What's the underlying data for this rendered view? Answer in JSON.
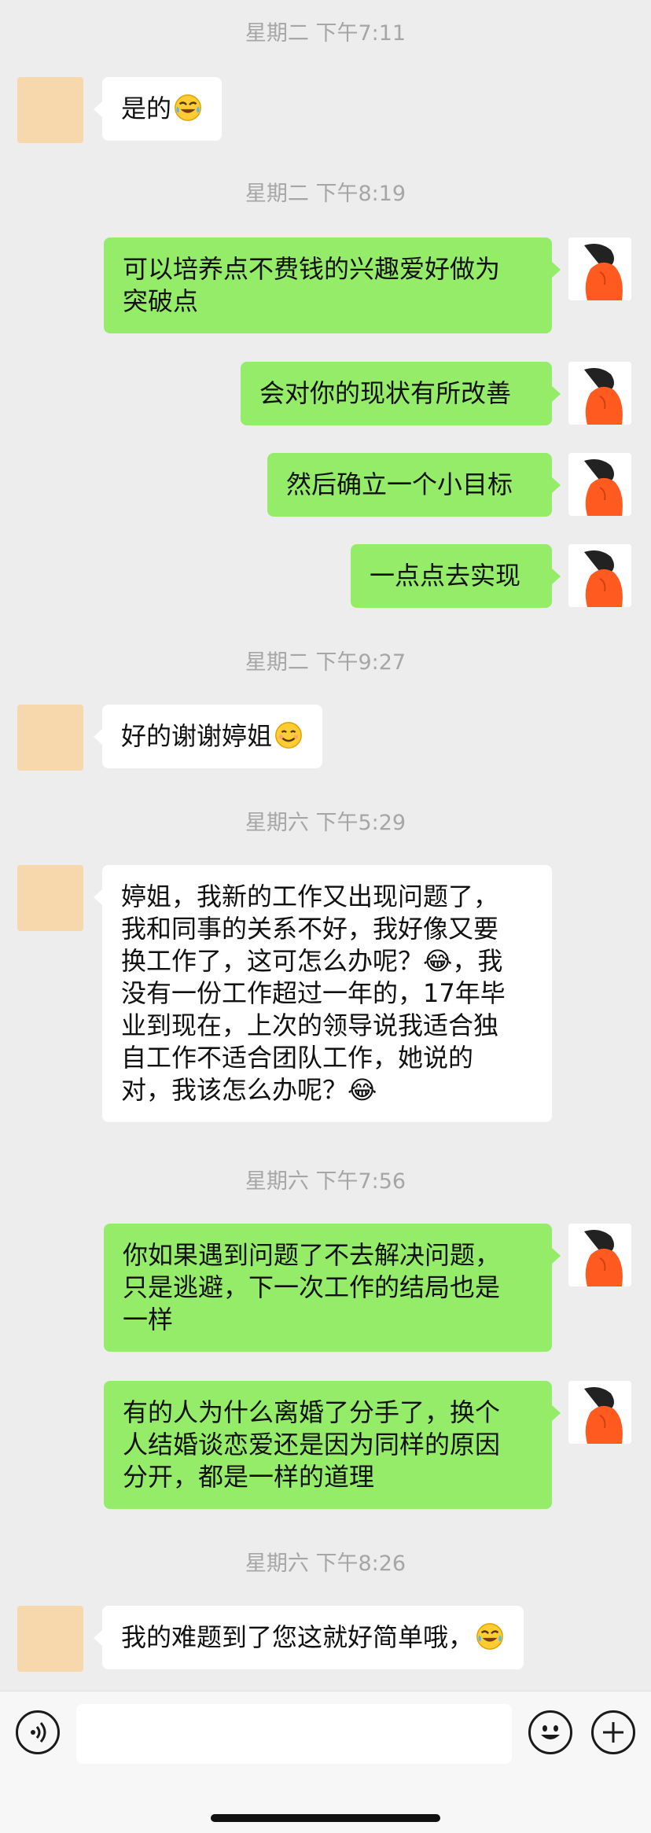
{
  "conversation": [
    {
      "kind": "timestamp",
      "text": "星期二 下午7:11"
    },
    {
      "kind": "message",
      "sender": "them",
      "text": "是的",
      "emoji": "rofl-emoji"
    },
    {
      "kind": "timestamp",
      "text": "星期二 下午8:19"
    },
    {
      "kind": "message",
      "sender": "me",
      "text": "可以培养点不费钱的兴趣爱好做为\n突破点"
    },
    {
      "kind": "message",
      "sender": "me",
      "text": "会对你的现状有所改善"
    },
    {
      "kind": "message",
      "sender": "me",
      "text": "然后确立一个小目标"
    },
    {
      "kind": "message",
      "sender": "me",
      "text": "一点点去实现"
    },
    {
      "kind": "timestamp",
      "text": "星期二 下午9:27"
    },
    {
      "kind": "message",
      "sender": "them",
      "text": "好的谢谢婷姐",
      "emoji": "smile-emoji"
    },
    {
      "kind": "timestamp",
      "text": "星期六 下午5:29"
    },
    {
      "kind": "message",
      "sender": "them",
      "text": "婷姐，我新的工作又出现问题了，\n我和同事的关系不好，我好像又要\n换工作了，这可怎么办呢？😂，我\n没有一份工作超过一年的，17年毕\n业到现在，上次的领导说我适合独\n自工作不适合团队工作，她说的\n对，我该怎么办呢？😂"
    },
    {
      "kind": "timestamp",
      "text": "星期六 下午7:56"
    },
    {
      "kind": "message",
      "sender": "me",
      "text": "你如果遇到问题了不去解决问题，\n只是逃避，下一次工作的结局也是\n一样"
    },
    {
      "kind": "message",
      "sender": "me",
      "text": "有的人为什么离婚了分手了，换个\n人结婚谈恋爱还是因为同样的原因\n分开，都是一样的道理"
    },
    {
      "kind": "timestamp",
      "text": "星期六 下午8:26"
    },
    {
      "kind": "message",
      "sender": "them",
      "text": "我的难题到了您这就好简单哦，",
      "emoji": "rofl-emoji"
    }
  ],
  "input_bar": {
    "voice_icon": "voice-icon",
    "emoji_icon": "emoji-picker-icon",
    "plus_icon": "plus-icon",
    "message_text": ""
  },
  "colors": {
    "background": "#ededed",
    "my_bubble": "#95ec69",
    "their_bubble": "#ffffff",
    "their_avatar": "#f7d8ac",
    "timestamp_text": "#a6a6a6"
  }
}
